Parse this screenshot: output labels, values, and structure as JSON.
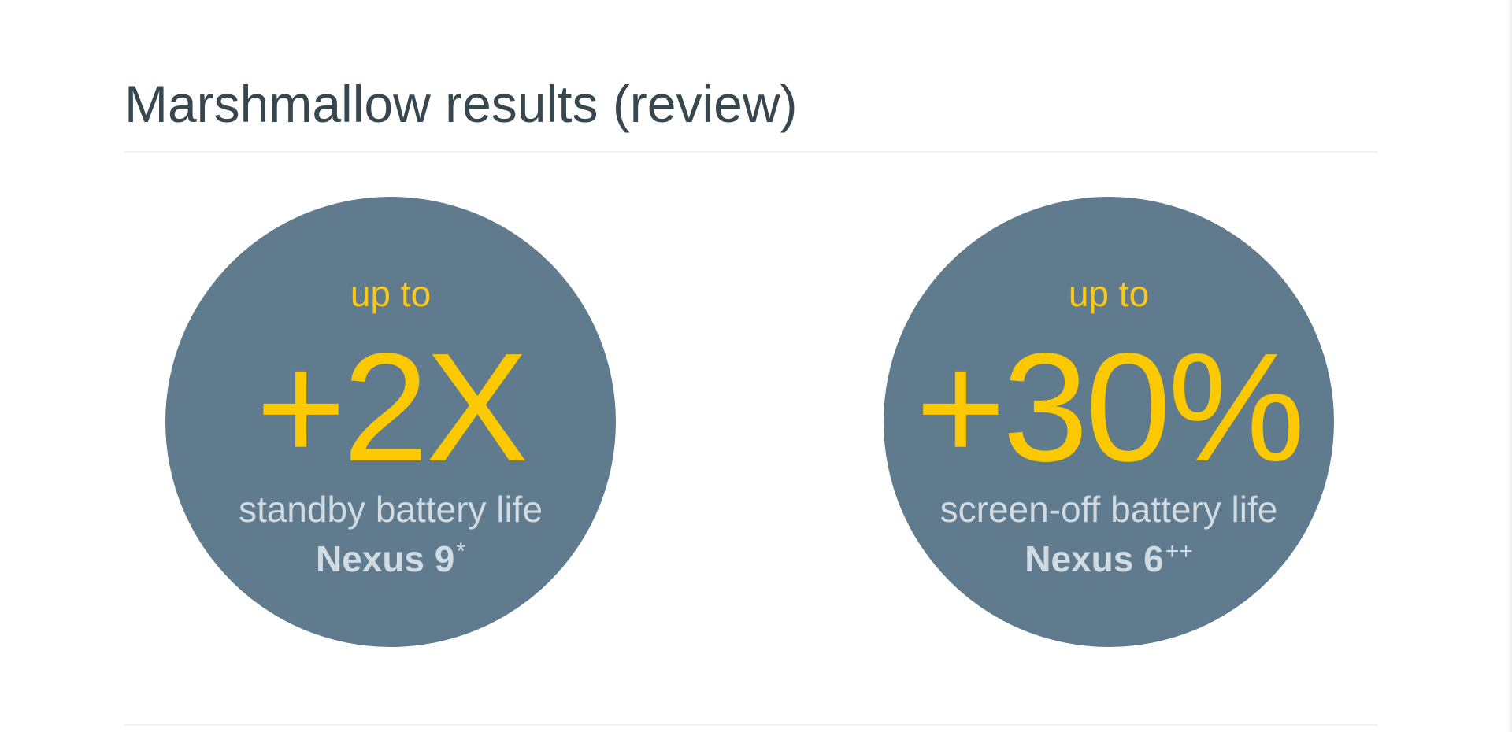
{
  "slide": {
    "title": "Marshmallow results (review)",
    "stats": [
      {
        "prefix": "up to",
        "value": "+2X",
        "description": "standby battery life",
        "device": "Nexus 9",
        "mark": "*"
      },
      {
        "prefix": "up to",
        "value": "+30%",
        "description": "screen-off battery life",
        "device": "Nexus 6",
        "mark": "++"
      }
    ]
  },
  "colors": {
    "circle": "#5f7b8d",
    "highlight": "#fcc900",
    "description_text": "#d1dbe2",
    "title_text": "#37474f",
    "background": "#ffffff"
  }
}
